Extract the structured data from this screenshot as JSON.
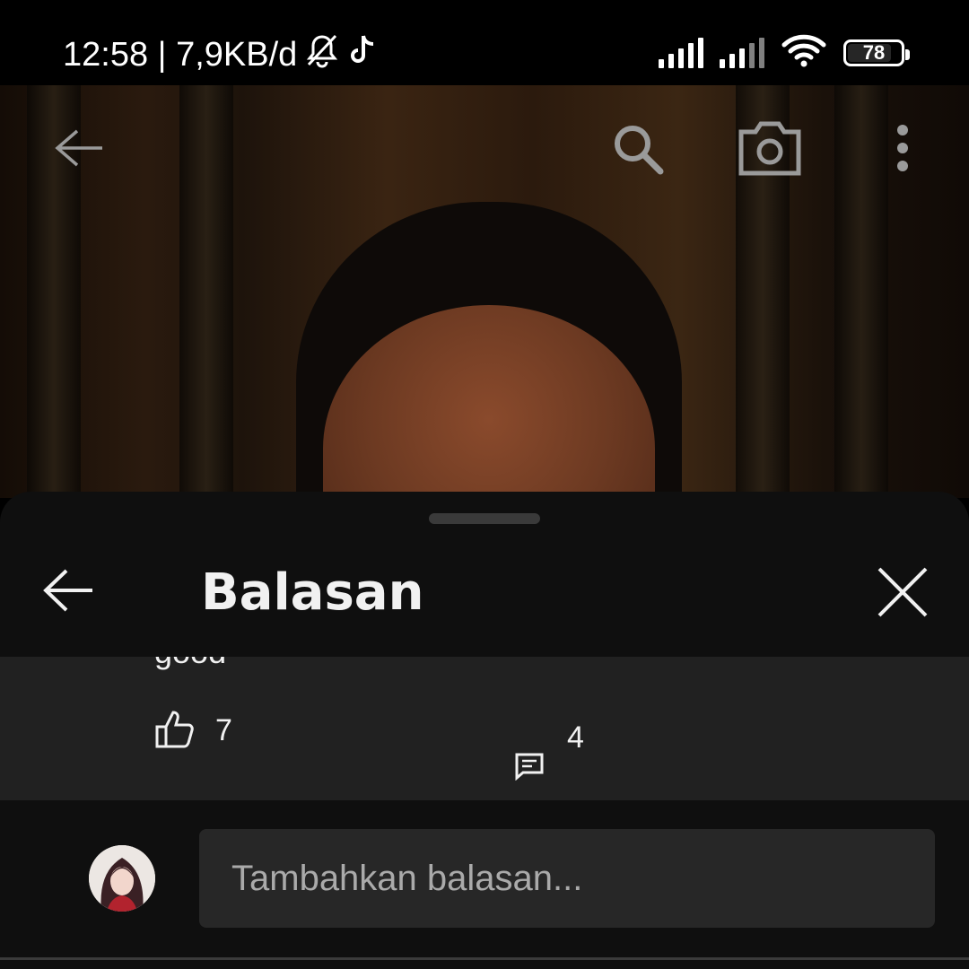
{
  "status_bar": {
    "time_speed": "12:58 | 7,9KB/d",
    "battery_level": "78",
    "icons": [
      "mute-bell-icon",
      "tiktok-icon",
      "signal-icon",
      "signal-icon",
      "wifi-icon",
      "battery-icon"
    ]
  },
  "video_toolbar": {
    "icons": [
      "back-arrow-icon",
      "search-icon",
      "camera-icon",
      "more-vertical-icon"
    ]
  },
  "sheet": {
    "title": "Balasan",
    "icons": [
      "back-arrow-icon",
      "close-icon"
    ]
  },
  "comment": {
    "cut_text": "good",
    "like_count": "7",
    "reply_count": "4",
    "icons": [
      "thumbs-up-icon",
      "reply-icon"
    ]
  },
  "reply_bar": {
    "placeholder": "Tambahkan balasan...",
    "icons": [
      "user-avatar"
    ]
  },
  "colors": {
    "sheet_bg": "#0f0f0f",
    "comment_bg": "#212121",
    "input_bg": "#272727",
    "text": "#f1f1f1",
    "muted": "#aaaaaa"
  }
}
